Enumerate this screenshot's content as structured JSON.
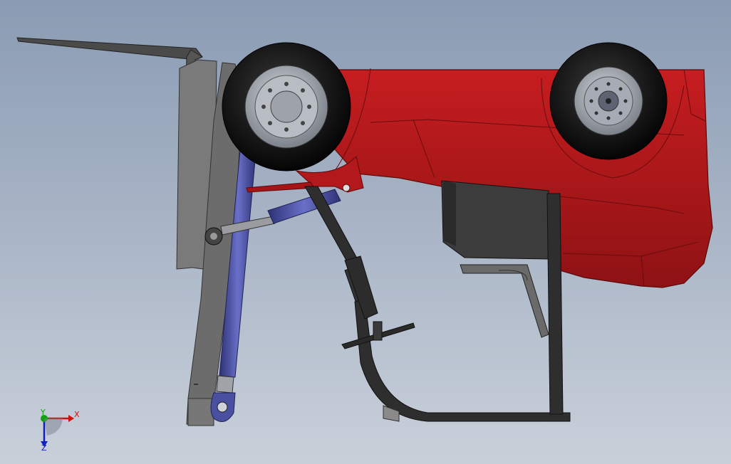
{
  "viewport": {
    "background_top": "#8a9bb3",
    "background_bottom": "#c9d0da"
  },
  "model": {
    "body_color": "#b3191c",
    "body_shade": "#8e1214",
    "tire_color": "#111111",
    "rim_color": "#9a9fa8",
    "mast_color": "#6e6e6e",
    "cylinder_color": "#4a4fa0",
    "frame_color": "#2e2e2e",
    "battery_color": "#3a3a3a"
  },
  "triad": {
    "x_label": "X",
    "y_label": "Y",
    "z_label": "Z",
    "x_color": "#d01010",
    "y_color": "#10a010",
    "z_color": "#1020c0"
  }
}
